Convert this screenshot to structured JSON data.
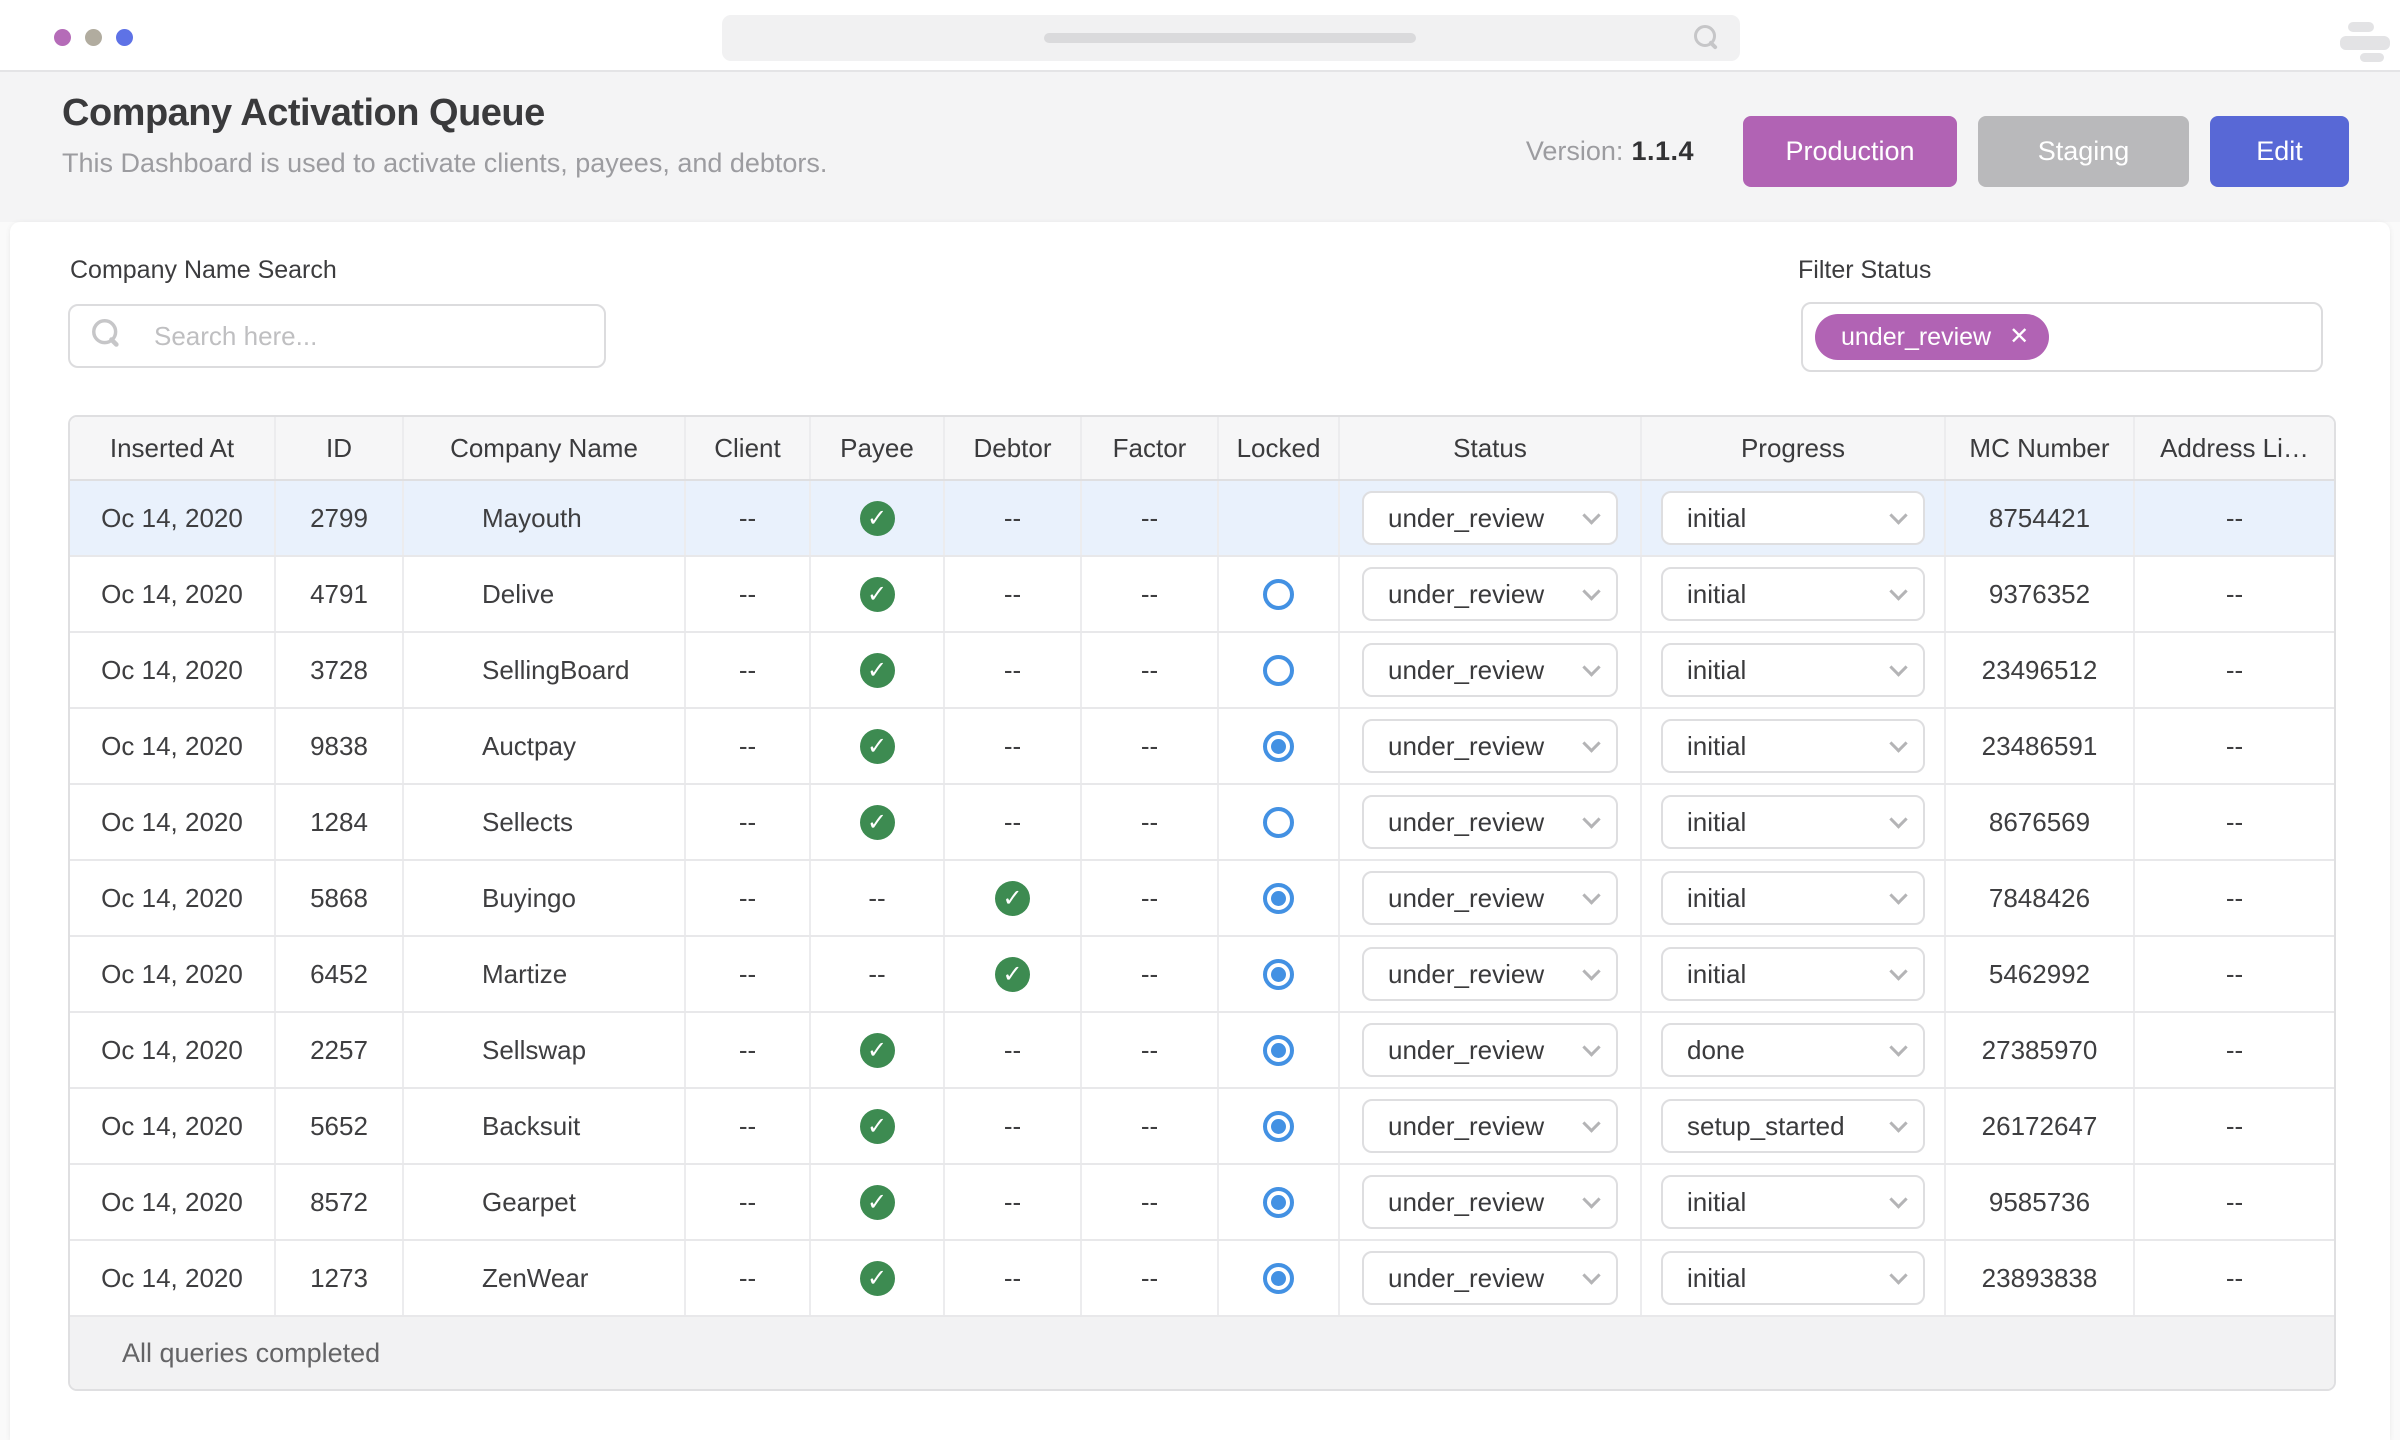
{
  "browser": {
    "window_dots": [
      "#b56cb8",
      "#b1ac9f",
      "#5e72e6"
    ],
    "icons": {
      "search": "magnifier-icon",
      "menu": "hamburger-menu-icon"
    }
  },
  "header": {
    "title": "Company Activation Queue",
    "subtitle": "This Dashboard is used to activate clients, payees, and debtors.",
    "version_label": "Version:",
    "version_value": "1.1.4",
    "buttons": [
      {
        "label": "Production",
        "color": "#b163b4"
      },
      {
        "label": "Staging",
        "color": "#b9b9bb"
      },
      {
        "label": "Edit",
        "color": "#5868d6"
      }
    ]
  },
  "filters": {
    "search_label": "Company Name Search",
    "search_placeholder": "Search here...",
    "filter_label": "Filter Status",
    "chip": {
      "label": "under_review",
      "close_icon": "x-icon",
      "color": "#b163b4"
    }
  },
  "colors": {
    "status_check_green": "#3d8b51",
    "radio_blue": "#4391e3",
    "highlighted_row": "#e9f1fc"
  },
  "table": {
    "columns": [
      "Inserted At",
      "ID",
      "Company Name",
      "Client",
      "Payee",
      "Debtor",
      "Factor",
      "Locked",
      "Status",
      "Progress",
      "MC Number",
      "Address Li…"
    ],
    "rows": [
      {
        "inserted_at": "Oc 14, 2020",
        "id": "2799",
        "company": "Mayouth",
        "client": "--",
        "payee": "check",
        "debtor": "--",
        "factor": "--",
        "locked": "none",
        "status": "under_review",
        "progress": "initial",
        "mc_number": "8754421",
        "address": "--",
        "highlighted": true
      },
      {
        "inserted_at": "Oc 14, 2020",
        "id": "4791",
        "company": "Delive",
        "client": "--",
        "payee": "check",
        "debtor": "--",
        "factor": "--",
        "locked": "unchecked",
        "status": "under_review",
        "progress": "initial",
        "mc_number": "9376352",
        "address": "--",
        "highlighted": false
      },
      {
        "inserted_at": "Oc 14, 2020",
        "id": "3728",
        "company": "SellingBoard",
        "client": "--",
        "payee": "check",
        "debtor": "--",
        "factor": "--",
        "locked": "unchecked",
        "status": "under_review",
        "progress": "initial",
        "mc_number": "23496512",
        "address": "--",
        "highlighted": false
      },
      {
        "inserted_at": "Oc 14, 2020",
        "id": "9838",
        "company": "Auctpay",
        "client": "--",
        "payee": "check",
        "debtor": "--",
        "factor": "--",
        "locked": "checked",
        "status": "under_review",
        "progress": "initial",
        "mc_number": "23486591",
        "address": "--",
        "highlighted": false
      },
      {
        "inserted_at": "Oc 14, 2020",
        "id": "1284",
        "company": "Sellects",
        "client": "--",
        "payee": "check",
        "debtor": "--",
        "factor": "--",
        "locked": "unchecked",
        "status": "under_review",
        "progress": "initial",
        "mc_number": "8676569",
        "address": "--",
        "highlighted": false
      },
      {
        "inserted_at": "Oc 14, 2020",
        "id": "5868",
        "company": "Buyingo",
        "client": "--",
        "payee": "--",
        "debtor": "check",
        "factor": "--",
        "locked": "checked",
        "status": "under_review",
        "progress": "initial",
        "mc_number": "7848426",
        "address": "--",
        "highlighted": false
      },
      {
        "inserted_at": "Oc 14, 2020",
        "id": "6452",
        "company": "Martize",
        "client": "--",
        "payee": "--",
        "debtor": "check",
        "factor": "--",
        "locked": "checked",
        "status": "under_review",
        "progress": "initial",
        "mc_number": "5462992",
        "address": "--",
        "highlighted": false
      },
      {
        "inserted_at": "Oc 14, 2020",
        "id": "2257",
        "company": "Sellswap",
        "client": "--",
        "payee": "check",
        "debtor": "--",
        "factor": "--",
        "locked": "checked",
        "status": "under_review",
        "progress": "done",
        "mc_number": "27385970",
        "address": "--",
        "highlighted": false
      },
      {
        "inserted_at": "Oc 14, 2020",
        "id": "5652",
        "company": "Backsuit",
        "client": "--",
        "payee": "check",
        "debtor": "--",
        "factor": "--",
        "locked": "checked",
        "status": "under_review",
        "progress": "setup_started",
        "mc_number": "26172647",
        "address": "--",
        "highlighted": false
      },
      {
        "inserted_at": "Oc 14, 2020",
        "id": "8572",
        "company": "Gearpet",
        "client": "--",
        "payee": "check",
        "debtor": "--",
        "factor": "--",
        "locked": "checked",
        "status": "under_review",
        "progress": "initial",
        "mc_number": "9585736",
        "address": "--",
        "highlighted": false
      },
      {
        "inserted_at": "Oc 14, 2020",
        "id": "1273",
        "company": "ZenWear",
        "client": "--",
        "payee": "check",
        "debtor": "--",
        "factor": "--",
        "locked": "checked",
        "status": "under_review",
        "progress": "initial",
        "mc_number": "23893838",
        "address": "--",
        "highlighted": false
      }
    ],
    "footer": "All queries completed"
  }
}
